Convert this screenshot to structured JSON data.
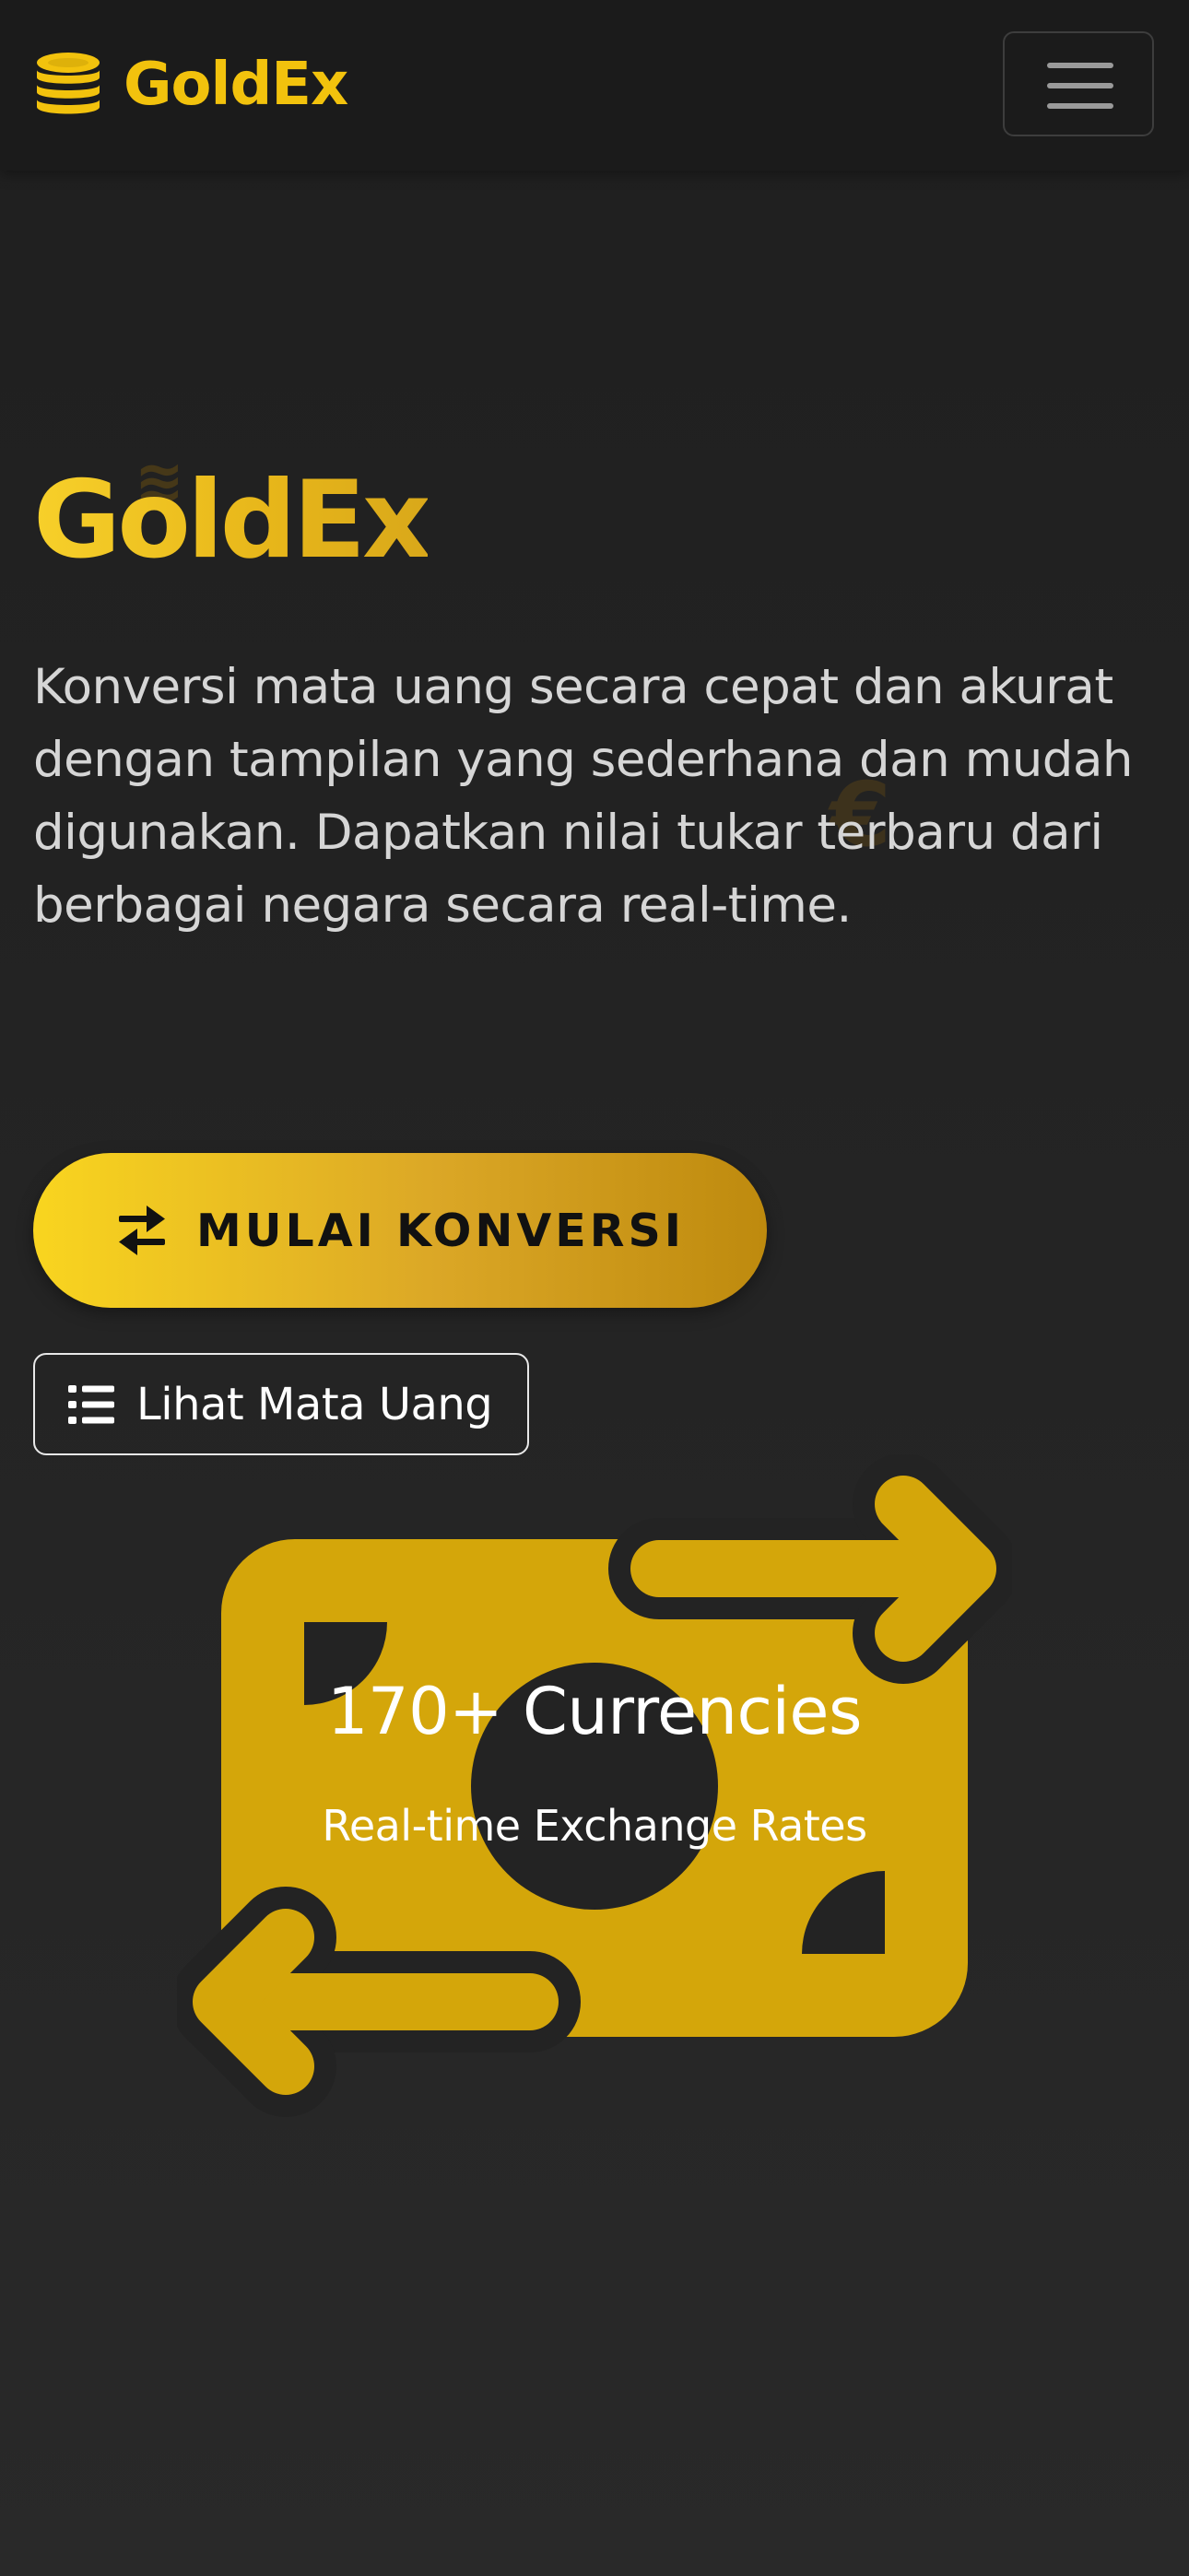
{
  "navbar": {
    "brand_name": "GoldEx",
    "brand_icon": "coins-icon",
    "menu_icon": "hamburger-icon"
  },
  "hero": {
    "title": "GoldEx",
    "description": "Konversi mata uang secara cepat dan akurat dengan tampilan yang sederhana dan mudah digunakan. Dapatkan nilai tukar terbaru dari berbagai negara secara real-time.",
    "decorative_symbols": [
      "€",
      "¥"
    ]
  },
  "buttons": {
    "primary_label": "MULAI KONVERSI",
    "primary_icon": "exchange-arrows-icon",
    "secondary_label": "Lihat Mata Uang",
    "secondary_icon": "list-icon"
  },
  "illustration": {
    "icon": "money-bill-transfer-icon",
    "title": "170+ Currencies",
    "subtitle": "Real-time Exchange Rates"
  },
  "colors": {
    "gold": "#f2c20d",
    "gold_dark": "#d4a60a",
    "background": "#222222",
    "navbar": "#1b1b1b"
  }
}
